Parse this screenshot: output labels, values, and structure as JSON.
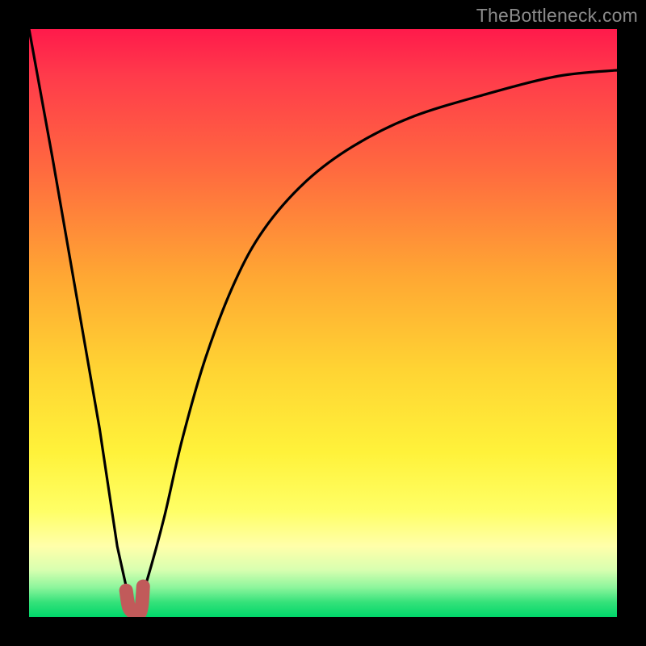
{
  "watermark": "TheBottleneck.com",
  "chart_data": {
    "type": "line",
    "title": "",
    "xlabel": "",
    "ylabel": "",
    "xlim": [
      0,
      100
    ],
    "ylim": [
      0,
      100
    ],
    "series": [
      {
        "name": "left-branch",
        "x": [
          0,
          4,
          8,
          12,
          15,
          17,
          18
        ],
        "values": [
          100,
          78,
          55,
          32,
          12,
          3,
          0
        ]
      },
      {
        "name": "right-branch",
        "x": [
          18,
          20,
          23,
          26,
          30,
          35,
          40,
          47,
          55,
          65,
          78,
          90,
          100
        ],
        "values": [
          0,
          6,
          17,
          30,
          44,
          57,
          66,
          74,
          80,
          85,
          89,
          92,
          93
        ]
      },
      {
        "name": "bottom-highlight",
        "x": [
          16.5,
          17,
          18,
          18.8,
          19.2,
          19.4
        ],
        "values": [
          4.5,
          1.6,
          0.6,
          0.6,
          2.2,
          5.2
        ]
      }
    ],
    "gradient_stops": [
      {
        "pos": 0.0,
        "color": "#ff1a4b"
      },
      {
        "pos": 0.24,
        "color": "#ff6a3f"
      },
      {
        "pos": 0.58,
        "color": "#ffd433"
      },
      {
        "pos": 0.82,
        "color": "#ffff66"
      },
      {
        "pos": 0.95,
        "color": "#8cf59c"
      },
      {
        "pos": 1.0,
        "color": "#00d66a"
      }
    ]
  }
}
